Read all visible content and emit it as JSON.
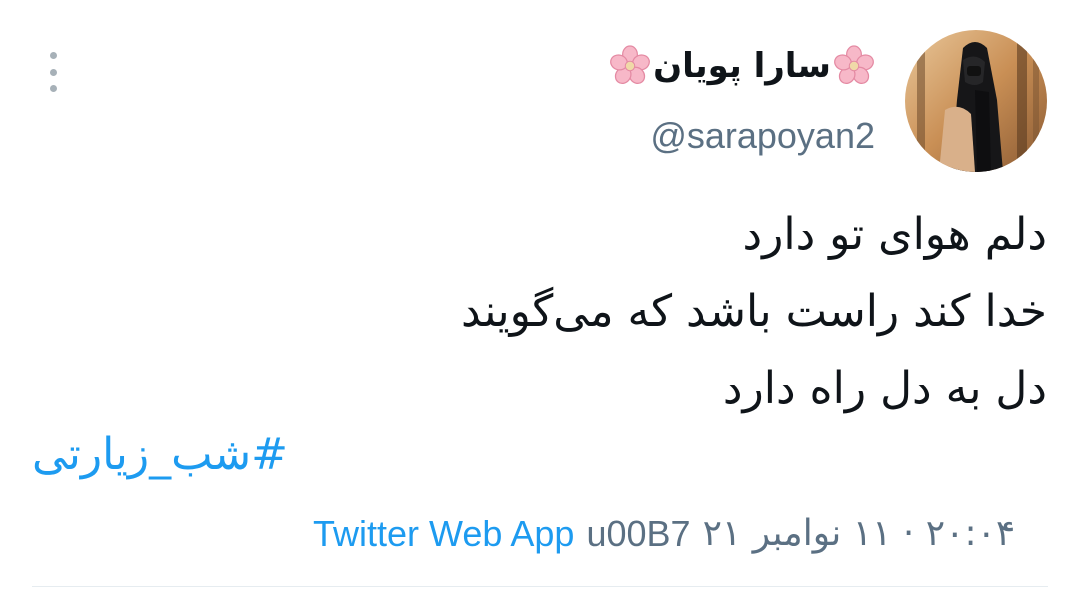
{
  "author": {
    "display_name": "سارا پویان",
    "handle": "@sarapoyan2"
  },
  "tweet": {
    "lines": [
      "دلم هوای تو دارد",
      "خدا کند راست باشد که می‌گویند",
      "دل به دل راه دارد"
    ],
    "hashtag": "#شب_زیارتی",
    "timestamp": "۲۰:۰۴ · ۱۱ نوامبر ۲۱",
    "separator": "u00B7",
    "source": "Twitter Web App"
  },
  "icons": {
    "menu": "more-vertical-icon",
    "name_decoration": "cherry-blossom-icon"
  },
  "colors": {
    "text": "#0f1419",
    "secondary": "#5b7083",
    "link": "#1d9bf0",
    "divider": "#e6ecf0"
  }
}
